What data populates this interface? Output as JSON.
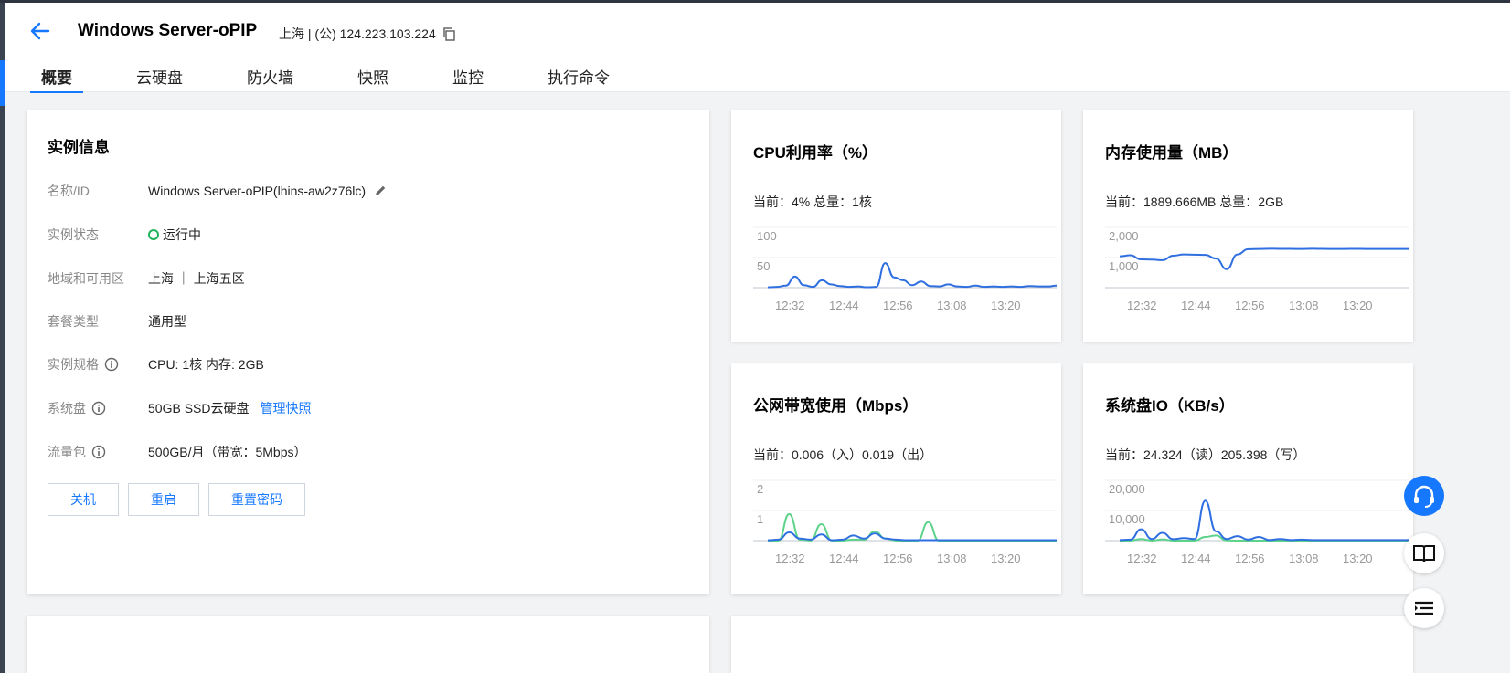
{
  "header": {
    "title": "Windows Server-oPIP",
    "meta": "上海 | (公) 124.223.103.224",
    "tabs": [
      "概要",
      "云硬盘",
      "防火墙",
      "快照",
      "监控",
      "执行命令"
    ]
  },
  "info": {
    "title": "实例信息",
    "rows": [
      {
        "label": "名称/ID",
        "value": "Windows Server-oPIP(lhins-aw2z76lc)"
      },
      {
        "label": "实例状态",
        "value": "运行中"
      },
      {
        "label": "地域和可用区",
        "value": "上海 ｜ 上海五区"
      },
      {
        "label": "套餐类型",
        "value": "通用型"
      },
      {
        "label": "实例规格",
        "value": "CPU: 1核 内存: 2GB"
      },
      {
        "label": "系统盘",
        "value": "50GB SSD云硬盘",
        "link": "管理快照"
      },
      {
        "label": "流量包",
        "value": "500GB/月（带宽：5Mbps）"
      }
    ],
    "buttons": [
      "关机",
      "重启",
      "重置密码"
    ]
  },
  "colors": {
    "accent": "#1677ff",
    "status_ok": "#1fb25a",
    "series_blue": "#2f6fe0",
    "series_green": "#5dd28a"
  },
  "icons": {
    "back": "arrow-left-icon",
    "copy": "copy-icon",
    "edit": "pencil-icon",
    "info": "info-circle-icon",
    "support": "headset-icon",
    "docs": "book-icon",
    "menu": "list-icon"
  },
  "charts": [
    {
      "title": "CPU利用率（%）",
      "sub": "当前：4% 总量：1核",
      "chart_data": {
        "type": "line",
        "x_ticks": [
          "12:32",
          "12:44",
          "12:56",
          "13:08",
          "13:20"
        ],
        "y_ticks": [
          "100",
          "50"
        ],
        "ylim": [
          0,
          100
        ],
        "series": [
          {
            "values": [
              1,
              2,
              5,
              27,
              6,
              2,
              18,
              8,
              4,
              2,
              3,
              1,
              2,
              60,
              25,
              18,
              6,
              15,
              4,
              3,
              8,
              3,
              2,
              5,
              2,
              3,
              2,
              3,
              2,
              4,
              3,
              3,
              5
            ]
          }
        ]
      }
    },
    {
      "title": "内存使用量（MB）",
      "sub": "当前：1889.666MB 总量：2GB",
      "chart_data": {
        "type": "line",
        "x_ticks": [
          "12:32",
          "12:44",
          "12:56",
          "13:08",
          "13:20"
        ],
        "y_ticks": [
          "2,000",
          "1,000"
        ],
        "ylim": [
          0,
          2000
        ],
        "series": [
          {
            "values": [
              1530,
              1580,
              1380,
              1370,
              1340,
              1560,
              1620,
              1610,
              1600,
              1420,
              900,
              1620,
              1880,
              1890,
              1900,
              1895,
              1892,
              1890,
              1900,
              1892,
              1890,
              1888,
              1895,
              1890,
              1888,
              1890,
              1889,
              1889
            ]
          }
        ]
      }
    },
    {
      "title": "公网带宽使用（Mbps）",
      "sub": "当前：0.006（入）0.019（出）",
      "chart_data": {
        "type": "line",
        "x_ticks": [
          "12:32",
          "12:44",
          "12:56",
          "13:08",
          "13:20"
        ],
        "y_ticks": [
          "2",
          "1"
        ],
        "ylim": [
          0,
          2
        ],
        "series": [
          {
            "values": [
              0.02,
              0.05,
              0.4,
              0.1,
              0.05,
              0.3,
              0.02,
              0.05,
              0.25,
              0.1,
              0.35,
              0.1,
              0.05,
              0.02,
              0.02,
              0.02,
              0.02,
              0.02,
              0.02,
              0.02,
              0.02,
              0.02,
              0.02,
              0.02,
              0.02,
              0.02,
              0.02,
              0.02
            ]
          },
          {
            "values": [
              0,
              0,
              1.3,
              0.05,
              0,
              0.8,
              0,
              0,
              0.05,
              0.05,
              0.45,
              0.1,
              0,
              0,
              0,
              0.9,
              0,
              0,
              0,
              0,
              0,
              0,
              0,
              0,
              0,
              0,
              0,
              0
            ]
          }
        ]
      }
    },
    {
      "title": "系统盘IO（KB/s）",
      "sub": "当前：24.324（读）205.398（写）",
      "chart_data": {
        "type": "line",
        "x_ticks": [
          "12:32",
          "12:44",
          "12:56",
          "13:08",
          "13:20"
        ],
        "y_ticks": [
          "20,000",
          "10,000"
        ],
        "ylim": [
          0,
          20000
        ],
        "series": [
          {
            "values": [
              300,
              500,
              5500,
              800,
              3800,
              700,
              1200,
              800,
              19500,
              4500,
              800,
              2200,
              500,
              1800,
              300,
              800,
              300,
              500,
              300,
              300,
              300,
              300,
              300,
              300,
              300,
              300,
              300,
              300
            ]
          },
          {
            "values": [
              0,
              0,
              800,
              0,
              600,
              0,
              0,
              0,
              1800,
              2500,
              100,
              0,
              0,
              0,
              0,
              0,
              0,
              0,
              0,
              0,
              0,
              0,
              0,
              0,
              0,
              0,
              0,
              0
            ]
          }
        ]
      }
    }
  ]
}
